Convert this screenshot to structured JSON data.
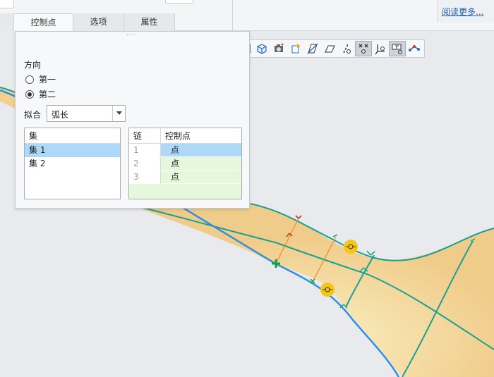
{
  "tabs": [
    {
      "label": "控制点",
      "active": true
    },
    {
      "label": "选项",
      "active": false
    },
    {
      "label": "属性",
      "active": false
    }
  ],
  "help": {
    "read_more": "阅读更多..."
  },
  "panel": {
    "direction_label": "方向",
    "direction_options": [
      {
        "label": "第一",
        "checked": false
      },
      {
        "label": "第二",
        "checked": true
      }
    ],
    "fit_label": "拟合",
    "fit_value": "弧长",
    "sets": {
      "header": "集",
      "items": [
        {
          "label": "集 1",
          "selected": true
        },
        {
          "label": "集 2",
          "selected": false
        }
      ]
    },
    "chains": {
      "headers": [
        "链",
        "控制点"
      ],
      "rows": [
        {
          "index": "1",
          "value": "点",
          "selected": true
        },
        {
          "index": "2",
          "value": "点",
          "selected": false
        },
        {
          "index": "3",
          "value": "点",
          "selected": false
        }
      ]
    }
  },
  "graphics_toolbar": [
    {
      "icon": "refit-icon",
      "on": false
    },
    {
      "icon": "saved-orientation-icon",
      "on": false
    },
    {
      "icon": "view-manager-icon",
      "on": false
    },
    {
      "icon": "datum-point-icon",
      "on": false
    },
    {
      "icon": "section-icon",
      "on": false
    },
    {
      "icon": "datum-plane-display-icon",
      "on": false
    },
    {
      "icon": "datum-axis-display-icon",
      "on": false
    },
    {
      "icon": "point-display-icon",
      "on": true
    },
    {
      "icon": "csys-display-icon",
      "on": false
    },
    {
      "icon": "annotation-display-icon",
      "on": true
    },
    {
      "icon": "spin-center-icon",
      "on": false
    }
  ],
  "colors": {
    "surface": "#f2d08e",
    "surface_edge": "#1aa090",
    "boundary_curve": "#2f8fe0",
    "control_handle": "#f5c518",
    "selection_bg": "#add8f7",
    "chain_bg": "#e6f8dc"
  }
}
